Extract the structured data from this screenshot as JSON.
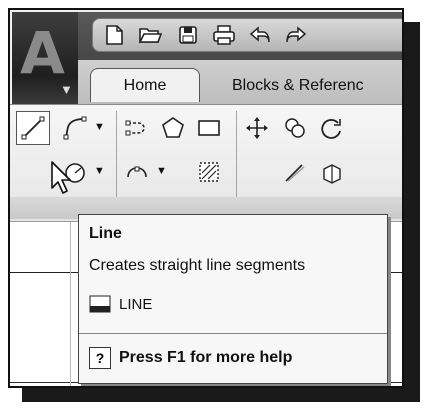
{
  "ribbon": {
    "tabs": [
      {
        "label": "Home",
        "active": true
      },
      {
        "label": "Blocks & Referenc"
      }
    ]
  },
  "quick_access": {
    "icons": [
      "new-file-icon",
      "open-folder-icon",
      "save-icon",
      "print-icon",
      "undo-icon",
      "redo-icon"
    ]
  },
  "draw_panel": {
    "tools": [
      "line",
      "polyline",
      "polygon",
      "rectangle",
      "circle",
      "arc",
      "hatch"
    ],
    "active_tool": "line"
  },
  "tooltip": {
    "title": "Line",
    "description": "Creates straight line segments",
    "command": "LINE",
    "help": "Press F1 for more help",
    "help_icon_glyph": "?"
  },
  "colors": {
    "ribbon_bg": "#e5e5e5",
    "titlebar_bg": "#474747",
    "tooltip_bg": "#f7f7f7"
  }
}
